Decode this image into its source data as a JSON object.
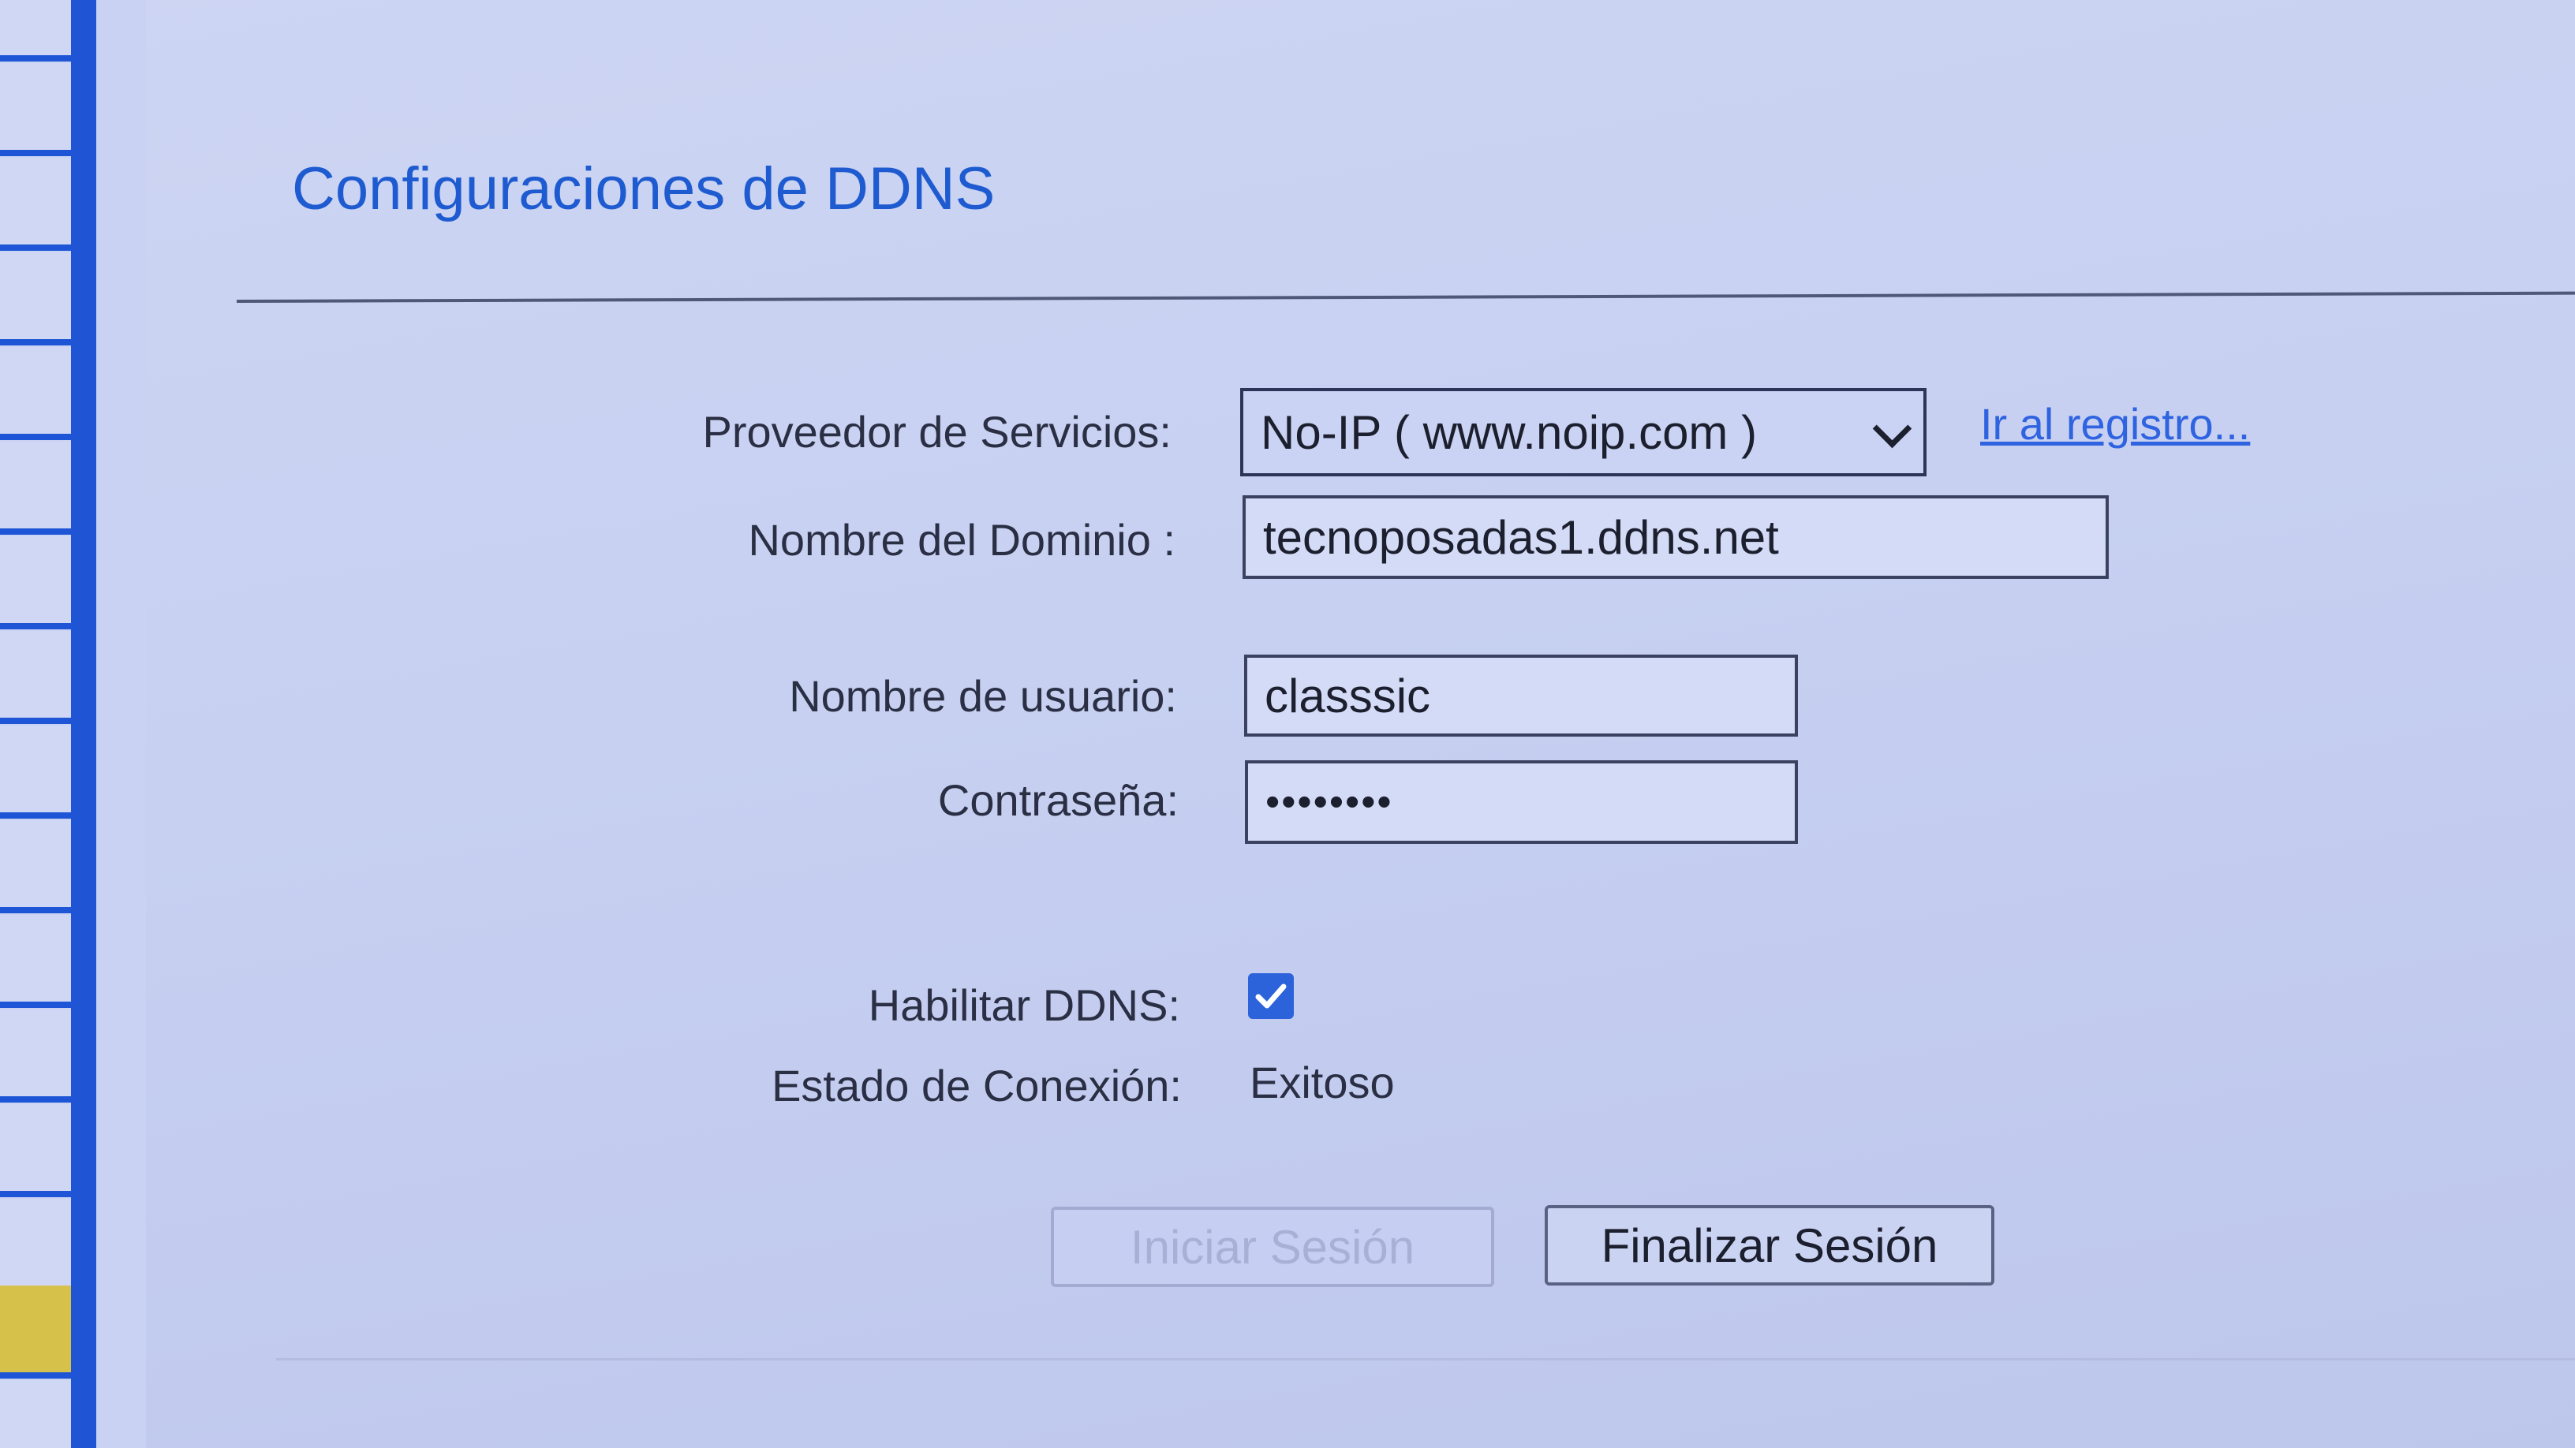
{
  "page": {
    "title": "Configuraciones de DDNS"
  },
  "form": {
    "provider": {
      "label": "Proveedor de Servicios:",
      "selected": "No-IP ( www.noip.com )",
      "register_link": "Ir al registro..."
    },
    "domain": {
      "label": "Nombre del Dominio :",
      "value": "tecnoposadas1.ddns.net"
    },
    "username": {
      "label": "Nombre de usuario:",
      "value": "classsic"
    },
    "password": {
      "label": "Contraseña:",
      "value": "••••••••"
    },
    "enable_ddns": {
      "label": "Habilitar DDNS:",
      "checked": true
    },
    "connection_status": {
      "label": "Estado de Conexión:",
      "value": "Exitoso"
    }
  },
  "buttons": {
    "login": "Iniciar Sesión",
    "logout": "Finalizar Sesión"
  },
  "colors": {
    "title": "#1e5bd0",
    "link": "#2f63e0",
    "checkbox": "#2c62da",
    "sidebar_bar": "#1f55d4"
  },
  "icons": {
    "provider_dropdown": "chevron-down-icon",
    "enable_ddns": "checkmark-icon"
  }
}
